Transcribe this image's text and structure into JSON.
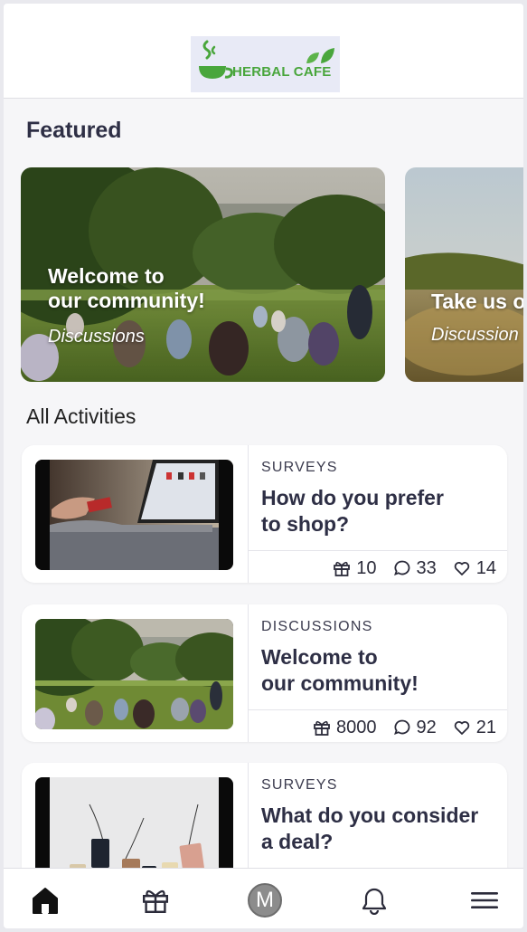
{
  "header": {
    "logo_text": "HERBAL CAFE",
    "logo_colors": {
      "brand_green": "#49a63c",
      "background": "#e8eaf6"
    }
  },
  "featured": {
    "title": "Featured",
    "cards": [
      {
        "title": "Welcome to\nour community!",
        "category": "Discussions"
      },
      {
        "title": "Take us o",
        "category": "Discussion"
      }
    ]
  },
  "activities": {
    "title": "All Activities",
    "items": [
      {
        "category": "SURVEYS",
        "title": "How do you prefer\nto shop?",
        "stats": {
          "gifts": "10",
          "comments": "33",
          "likes": "14"
        }
      },
      {
        "category": "DISCUSSIONS",
        "title": "Welcome to\nour community!",
        "stats": {
          "gifts": "8000",
          "comments": "92",
          "likes": "21"
        }
      },
      {
        "category": "SURVEYS",
        "title": "What do you consider\na deal?",
        "stats": {
          "gifts": "",
          "comments": "",
          "likes": ""
        }
      }
    ]
  },
  "bottom_nav": {
    "items": [
      {
        "icon": "home-icon",
        "active": true
      },
      {
        "icon": "gift-icon"
      },
      {
        "icon": "avatar",
        "initial": "M"
      },
      {
        "icon": "bell-icon"
      },
      {
        "icon": "menu-icon"
      }
    ]
  }
}
